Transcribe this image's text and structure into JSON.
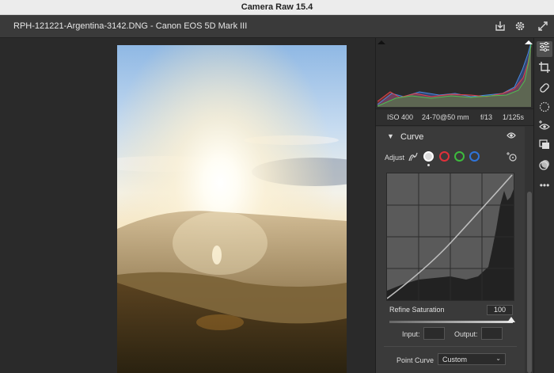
{
  "app": {
    "title": "Camera Raw 15.4"
  },
  "file": {
    "title": "RPH-121221-Argentina-3142.DNG  -  Canon EOS 5D Mark III"
  },
  "icons": {
    "save": "download-icon",
    "settings": "gear-icon",
    "fullscreen": "expand-icon"
  },
  "exif": {
    "iso": "ISO 400",
    "lens": "24-70@50 mm",
    "aperture": "f/13",
    "shutter": "1/125s"
  },
  "curve_panel": {
    "title": "Curve",
    "adjust_label": "Adjust",
    "channels": [
      "parametric",
      "rgb",
      "red",
      "green",
      "blue"
    ],
    "channel_colors": {
      "red": "#e0303a",
      "green": "#3dbb3d",
      "blue": "#2f74d9",
      "rgb": "#ffffff"
    },
    "refine_saturation_label": "Refine Saturation",
    "refine_saturation_value": "100",
    "refine_saturation_fraction": 1.0,
    "input_label": "Input:",
    "output_label": "Output:",
    "input_value": "",
    "output_value": "",
    "point_curve_label": "Point Curve",
    "point_curve_value": "Custom"
  },
  "toolbar": {
    "tools": [
      "edit-sliders-icon",
      "crop-icon",
      "healing-icon",
      "masking-icon",
      "redeye-icon",
      "presets-icon",
      "snapshots-icon",
      "more-icon"
    ],
    "active": "edit-sliders-icon"
  }
}
